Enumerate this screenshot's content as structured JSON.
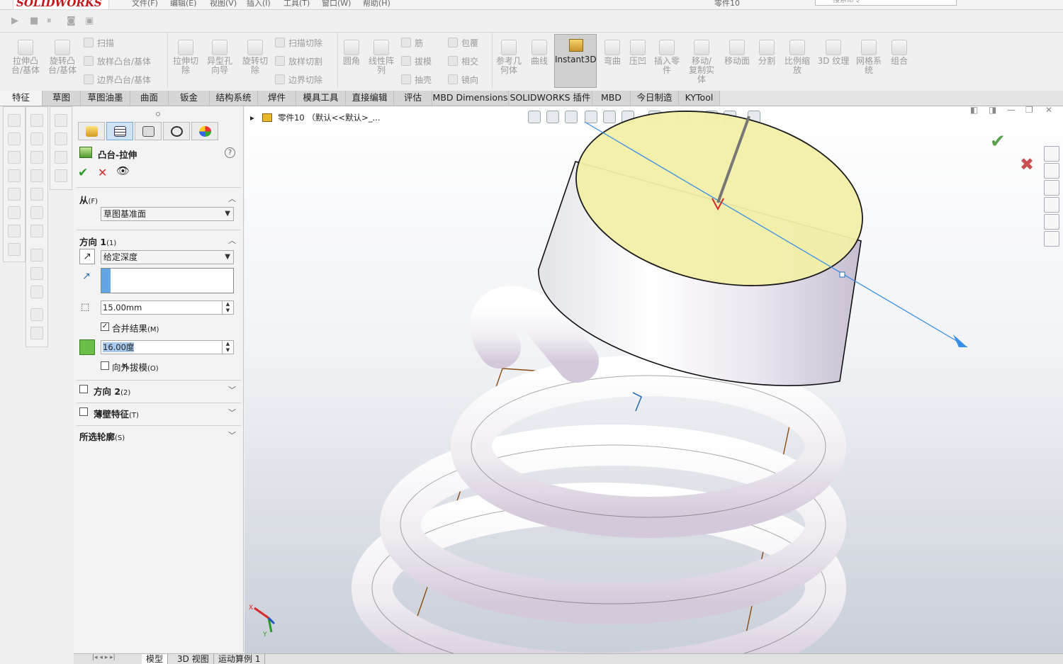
{
  "app": {
    "logo": "SOLIDWORKS",
    "menu": [
      "文件(F)",
      "编辑(E)",
      "视图(V)",
      "插入(I)",
      "工具(T)",
      "窗口(W)",
      "帮助(H)"
    ],
    "doc_title": "零件10",
    "search_placeholder": "搜索命令",
    "accent": "#c4161c"
  },
  "ribbon": {
    "extrude_boss": "拉伸凸\n台/基体",
    "revolve_boss": "旋转凸\n台/基体",
    "sweep": "扫描",
    "loft": "放样凸台/基体",
    "boundary": "边界凸台/基体",
    "extrude_cut": "拉伸切\n除",
    "hole_wizard": "异型孔\n向导",
    "revolve_cut": "旋转切\n除",
    "sweep_cut": "扫描切除",
    "loft_cut": "放样切割",
    "boundary_cut": "边界切除",
    "fillet": "圆角",
    "linear_pattern": "线性阵\n列",
    "rib": "筋",
    "draft": "拔模",
    "shell": "抽壳",
    "wrap": "包覆",
    "intersect": "相交",
    "mirror": "镜向",
    "ref_geometry": "参考几\n何体",
    "curves": "曲线",
    "instant3d": "Instant3D",
    "flex": "弯曲",
    "indent": "压凹",
    "insert_part": "插入零\n件",
    "move_copy": "移动/\n复制实\n体",
    "move_face": "移动面",
    "split": "分割",
    "scale": "比例缩\n放",
    "texture3d": "3D 纹理",
    "mesh": "网格系\n统",
    "combine": "组合"
  },
  "tabs": [
    "特征",
    "草图",
    "草图油墨",
    "曲面",
    "钣金",
    "结构系统",
    "焊件",
    "模具工具",
    "直接编辑",
    "评估",
    "MBD Dimensions",
    "SOLIDWORKS 插件",
    "MBD",
    "今日制造",
    "KYTool"
  ],
  "pm": {
    "title": "凸台-拉伸",
    "help": "?",
    "from_label": "从",
    "from_key": "(F)",
    "from_value": "草图基准面",
    "dir1_label": "方向 1",
    "dir1_key": "(1)",
    "end_condition": "给定深度",
    "depth": "15.00mm",
    "merge_label": "合并结果",
    "merge_key": "(M)",
    "merge_checked": true,
    "draft_angle": "16.00度",
    "draft_out_label": "向外拔模",
    "draft_out_key": "(O)",
    "draft_out_checked": false,
    "dir2_label": "方向 2",
    "dir2_key": "(2)",
    "thin_label": "薄壁特征",
    "thin_key": "(T)",
    "contours_label": "所选轮廓",
    "contours_key": "(S)"
  },
  "gfx": {
    "tree_path": "零件10 （默认<<默认>_..."
  },
  "bottom_tabs": [
    "模型",
    "3D 视图",
    "运动算例 1"
  ],
  "colors": {
    "preview_face": "#f3f0a8",
    "spring": "#f4f2f6",
    "axis_blue": "#3a8ee6",
    "sketch_line": "#8a4b12"
  }
}
